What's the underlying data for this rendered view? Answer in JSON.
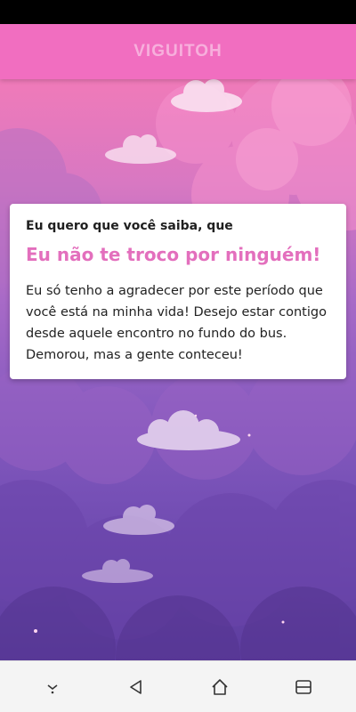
{
  "app_bar": {
    "title": "VIGUITOH"
  },
  "card": {
    "subtitle": "Eu quero que você saiba, que",
    "title": "Eu não te troco por ninguém!",
    "body": "Eu só tenho a agradecer por este período que você está na minha vida! Desejo estar contigo desde aquele encontro no fundo do bus. Demorou, mas a gente conteceu!"
  },
  "colors": {
    "app_bar": "#f16ec0",
    "accent_text": "#e36fbd",
    "sky_top": "#f07ab9",
    "sky_bottom": "#5c3c9e"
  },
  "nav": {
    "items": [
      {
        "icon": "hide-keyboard-icon"
      },
      {
        "icon": "back-icon"
      },
      {
        "icon": "home-icon"
      },
      {
        "icon": "recents-icon"
      }
    ]
  }
}
